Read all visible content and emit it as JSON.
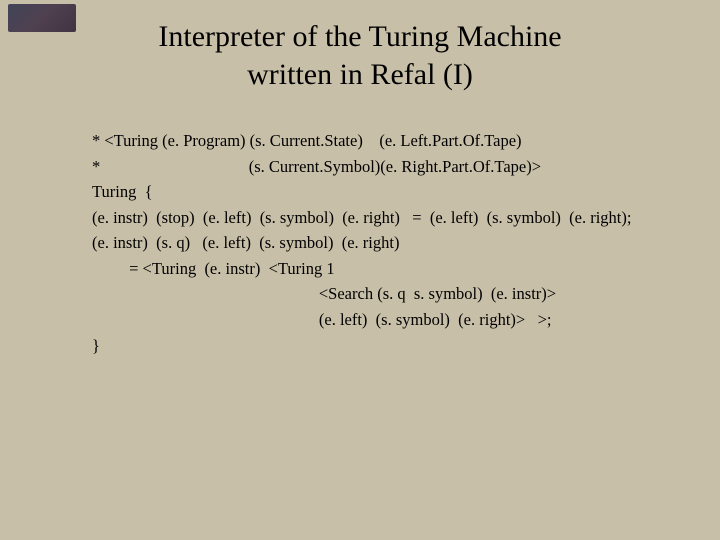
{
  "logo": {
    "alt": "decorative-logo"
  },
  "title": {
    "line1": "Interpreter of the Turing Machine",
    "line2": "written in Refal (I)"
  },
  "code": {
    "l1": "* <Turing (e. Program) (s. Current.State)    (e. Left.Part.Of.Tape)",
    "l2": "*                                    (s. Current.Symbol)(e. Right.Part.Of.Tape)>",
    "l3": "Turing  {",
    "l4": "(e. instr)  (stop)  (e. left)  (s. symbol)  (e. right)   =  (e. left)  (s. symbol)  (e. right);",
    "l5": "(e. instr)  (s. q)   (e. left)  (s. symbol)  (e. right)",
    "l6": "         = <Turing  (e. instr)  <Turing 1",
    "l7": "                                                       <Search (s. q  s. symbol)  (e. instr)>",
    "l8": "                                                       (e. left)  (s. symbol)  (e. right)>   >;",
    "l9": "}"
  }
}
